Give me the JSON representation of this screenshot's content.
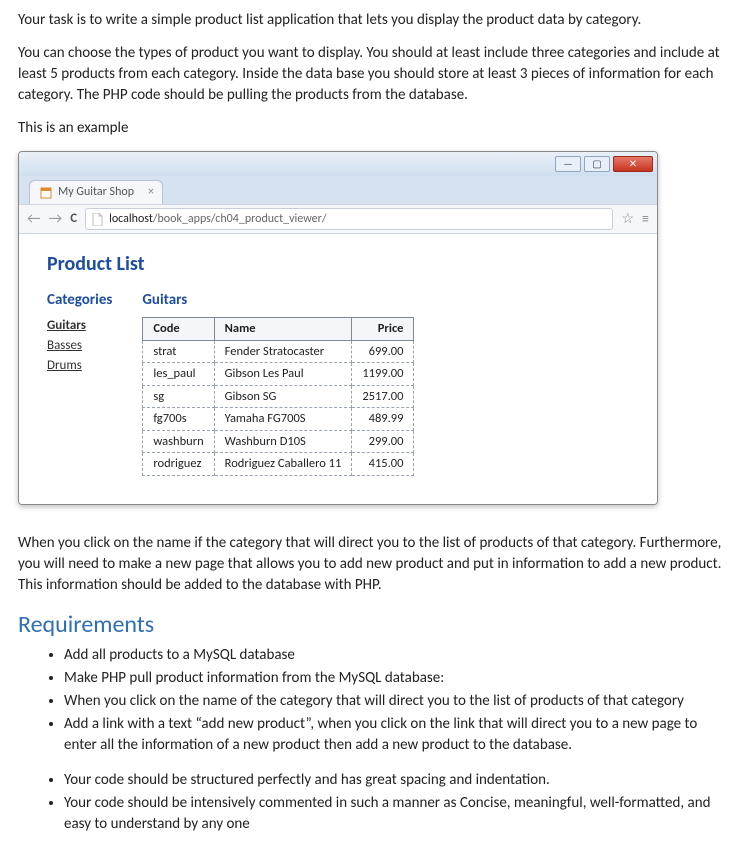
{
  "intro": {
    "p1": "Your task is to write a simple product list application that lets you display the product data by category.",
    "p2": "You can choose the types of product you want to display. You should at least include three categories and include at least 5 products from each category. Inside the data base you should store at least 3 pieces of information for each category. The PHP code should be pulling the products from the database.",
    "p3": "This is an example"
  },
  "browser": {
    "tab_title": "My Guitar Shop",
    "url_host": "localhost",
    "url_path": "/book_apps/ch04_product_viewer/"
  },
  "app": {
    "title": "Product List",
    "categories_header": "Categories",
    "table_header": "Guitars",
    "categories": [
      "Guitars",
      "Basses",
      "Drums"
    ],
    "active_category_index": 0,
    "columns": {
      "code": "Code",
      "name": "Name",
      "price": "Price"
    },
    "rows": [
      {
        "code": "strat",
        "name": "Fender Stratocaster",
        "price": "699.00"
      },
      {
        "code": "les_paul",
        "name": "Gibson Les Paul",
        "price": "1199.00"
      },
      {
        "code": "sg",
        "name": "Gibson SG",
        "price": "2517.00"
      },
      {
        "code": "fg700s",
        "name": "Yamaha FG700S",
        "price": "489.99"
      },
      {
        "code": "washburn",
        "name": "Washburn D10S",
        "price": "299.00"
      },
      {
        "code": "rodriguez",
        "name": "Rodriguez Caballero 11",
        "price": "415.00"
      }
    ]
  },
  "post": {
    "p1": "When you click on the name if the category that will direct you to the list of products of that category. Furthermore, you will need to make a new page that allows you to add new product and put in information to add a new product. This information should be added to the database with PHP."
  },
  "requirements": {
    "heading": "Requirements",
    "group1": [
      "Add all products to a MySQL database",
      "Make PHP pull product information from the MySQL database:",
      "When you click on the name of the category that will direct you to the list of products of that category",
      "Add a link with a text “add new product”, when you click on the link that will direct you to a new page to enter all the information of a new product then add a new product to the database."
    ],
    "group2": [
      "Your code should be structured perfectly and has great spacing and indentation.",
      "Your code should be intensively commented in such a manner as Concise, meaningful, well-formatted, and easy to understand by any one"
    ]
  }
}
